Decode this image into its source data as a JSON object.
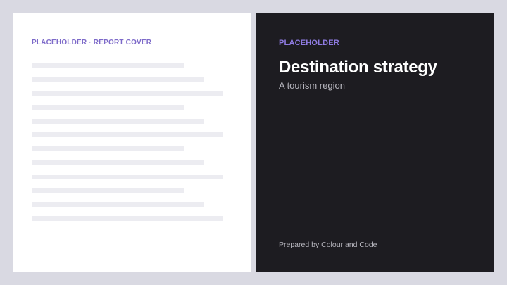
{
  "left_panel": {
    "label": "PLACEHOLDER · REPORT COVER"
  },
  "right_panel": {
    "label": "PLACEHOLDER",
    "title": "Destination strategy",
    "subtitle": "A tourism region",
    "footer": "Prepared by Colour and Code"
  },
  "colors": {
    "accent": "#7d6ac9",
    "dark_panel": "#1d1c21",
    "background": "#d9d9e2"
  }
}
